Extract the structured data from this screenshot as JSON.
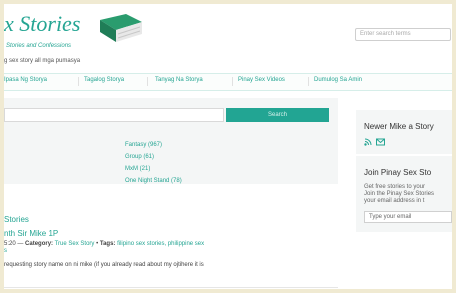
{
  "header": {
    "logo_title": "x Stories",
    "logo_subtitle": "Stories and Confessions",
    "tagline": "g sex story all mga pumasya",
    "search_placeholder": "Enter search terms"
  },
  "nav": {
    "items": [
      "Ipasa Ng Storya",
      "Tagalog Storya",
      "Tanyag Na Storya",
      "Pinay Sex Videos",
      "Dumulog Sa Amin"
    ]
  },
  "main_search": {
    "button_label": "Search"
  },
  "categories": [
    "Fantasy (967)",
    "Group (61)",
    "MxM (21)",
    "One Night Stand (78)"
  ],
  "posts": {
    "section_heading": "Stories",
    "title": "nth Sir Mike  1P",
    "date": "5:20",
    "category_label": "Category:",
    "category_value": "True Sex Story",
    "tags_label": "Tags:",
    "tags_value": "filipino sex stories, philippine sex",
    "tags_more": "s",
    "excerpt": "requesting story name on ni mike (if you already read about my ojtihere it is"
  },
  "sidebar": {
    "newer_title": "Newer Mike a Story",
    "newer_icons": [
      "rss-icon",
      "email-icon"
    ],
    "join_title": "Join Pinay Sex Sto",
    "join_text": [
      "Get free stories to your",
      "Join the Pinay Sex Stories",
      "your email address in t"
    ],
    "email_placeholder": "Type your email"
  },
  "colors": {
    "accent": "#25a593",
    "frame": "#f0ead2"
  }
}
